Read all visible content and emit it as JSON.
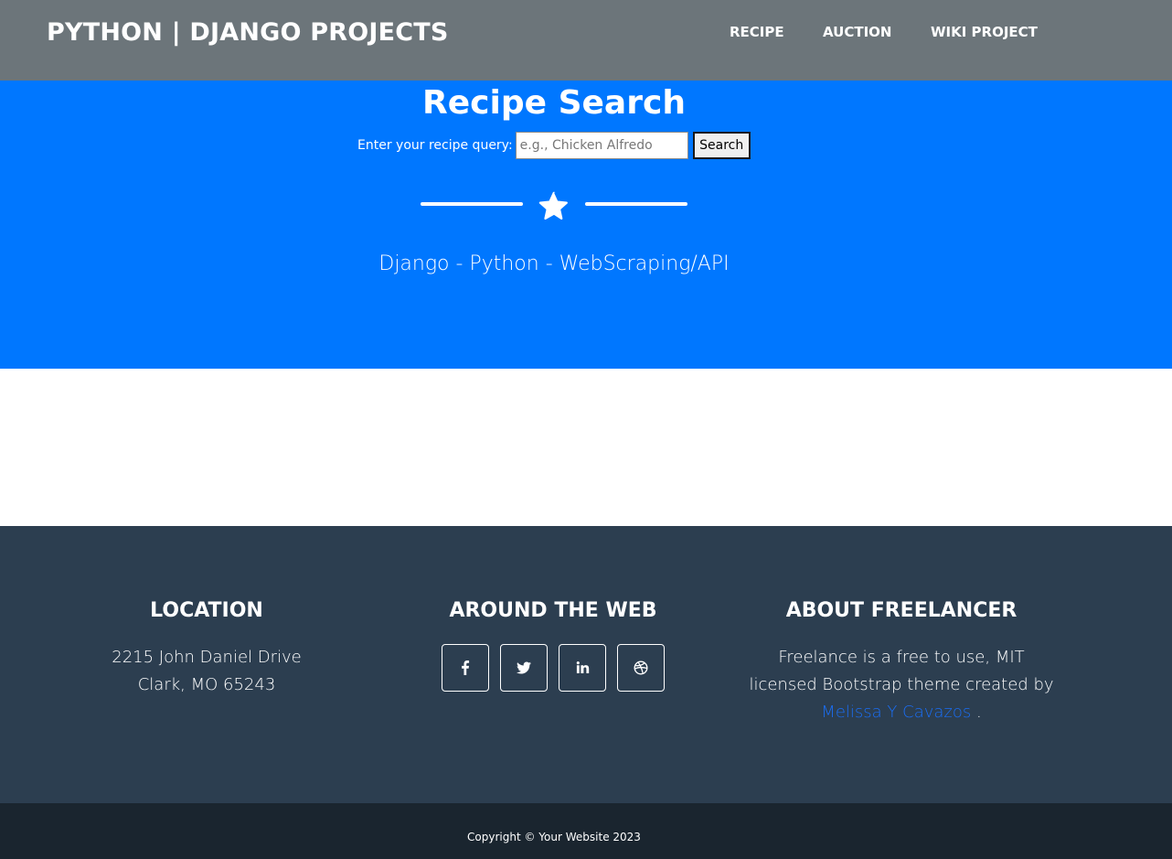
{
  "navbar": {
    "brand": "PYTHON | DJANGO PROJECTS",
    "links": [
      "RECIPE",
      "AUCTION",
      "WIKI PROJECT"
    ]
  },
  "hero": {
    "title": "Recipe Search",
    "search_label": "Enter your recipe query:",
    "search_placeholder": "e.g., Chicken Alfredo",
    "search_value": "",
    "search_button": "Search",
    "divider_icon": "star-icon",
    "subtitle": "Django - Python - WebScraping/API"
  },
  "footer": {
    "location": {
      "title": "LOCATION",
      "line1": "2215 John Daniel Drive",
      "line2": "Clark, MO 65243"
    },
    "web": {
      "title": "AROUND THE WEB",
      "icons": [
        "facebook-icon",
        "twitter-icon",
        "linkedin-icon",
        "dribbble-icon"
      ]
    },
    "about": {
      "title": "ABOUT FREELANCER",
      "text_before": "Freelance is a free to use, MIT licensed Bootstrap theme created by ",
      "link_text": "Melissa Y Cavazos",
      "text_after": " ."
    }
  },
  "copyright": {
    "text": "Copyright © Your Website 2023"
  },
  "colors": {
    "navbar_bg": "#6c757a",
    "hero_bg": "#0077ff",
    "footer_bg": "#2c3e50",
    "copyright_bg": "#1a252f",
    "link": "#1a6ef5"
  }
}
